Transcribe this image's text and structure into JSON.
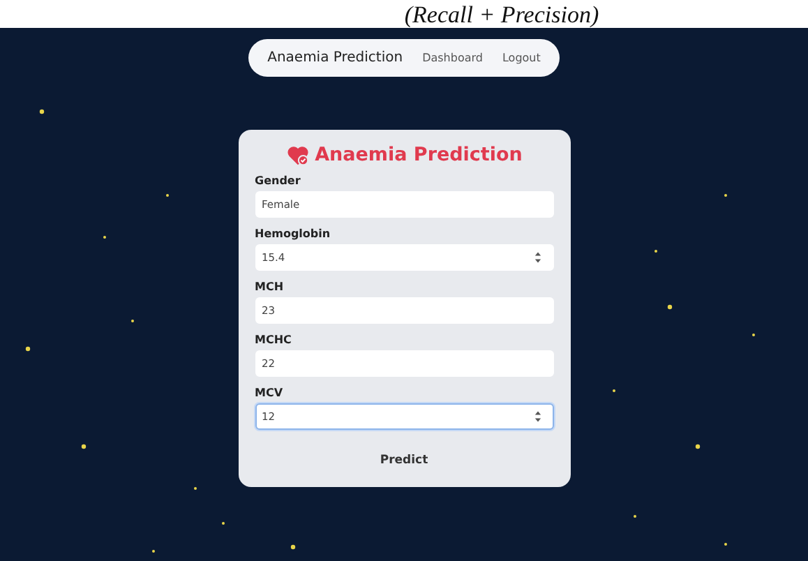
{
  "document_caption": "(Recall + Precision)",
  "navbar": {
    "brand": "Anaemia Prediction",
    "links": [
      "Dashboard",
      "Logout"
    ]
  },
  "card": {
    "title": "Anaemia Prediction",
    "fields": [
      {
        "label": "Gender",
        "value": "Female",
        "kind": "text",
        "focused": false
      },
      {
        "label": "Hemoglobin",
        "value": "15.4",
        "kind": "number",
        "focused": false
      },
      {
        "label": "MCH",
        "value": "23",
        "kind": "text",
        "focused": false
      },
      {
        "label": "MCHC",
        "value": "22",
        "kind": "text",
        "focused": false
      },
      {
        "label": "MCV",
        "value": "12",
        "kind": "number",
        "focused": true
      }
    ],
    "button": "Predict"
  }
}
